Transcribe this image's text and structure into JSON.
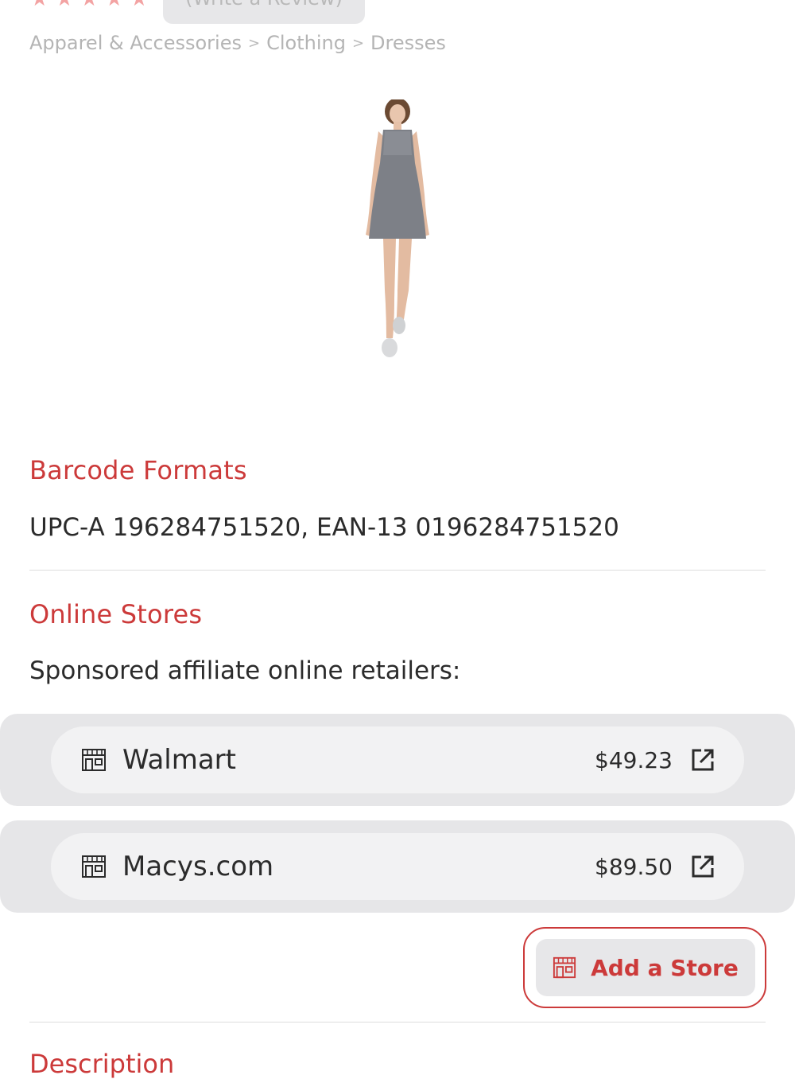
{
  "rating": {
    "stars": 5,
    "review_button_label": "(Write a Review)"
  },
  "breadcrumb": [
    "Apparel & Accessories",
    "Clothing",
    "Dresses"
  ],
  "product": {
    "image_alt": "Gray racerback dress worn by model"
  },
  "barcode": {
    "title": "Barcode Formats",
    "value": "UPC-A 196284751520, EAN-13 0196284751520"
  },
  "online_stores": {
    "title": "Online Stores",
    "subtitle": "Sponsored affiliate online retailers:",
    "stores": [
      {
        "name": "Walmart",
        "price": "$49.23",
        "icon": "store-icon"
      },
      {
        "name": "Macys.com",
        "price": "$89.50",
        "icon": "store-icon"
      }
    ],
    "add_store_label": "Add a Store"
  },
  "next_section_title": "Description",
  "colors": {
    "accent": "#cc3a3a",
    "card": "#e6e6e8",
    "pill": "#f2f2f3",
    "muted": "#b4b4b4"
  }
}
